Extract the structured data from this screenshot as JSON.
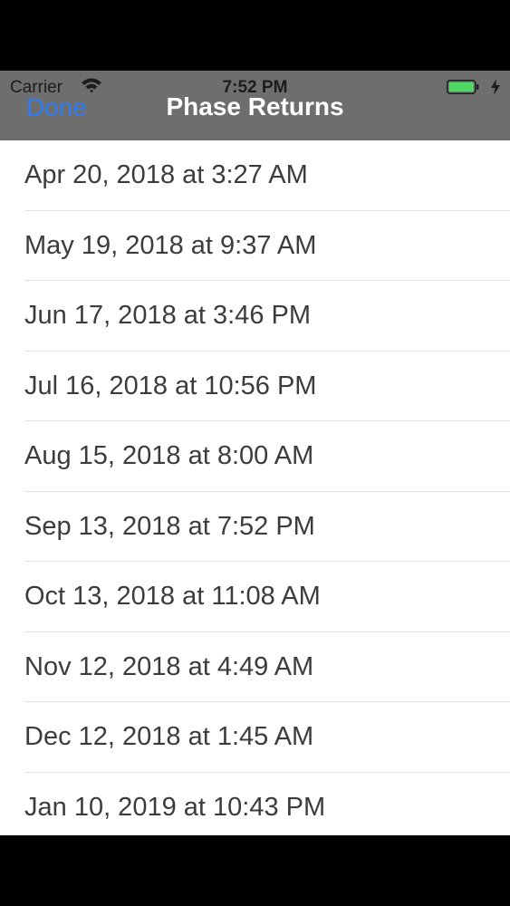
{
  "status_bar": {
    "carrier": "Carrier",
    "time": "7:52 PM",
    "wifi_icon": "wifi-icon",
    "battery_icon": "battery-icon",
    "charging_icon": "charging-bolt-icon",
    "battery_color": "#4cd964"
  },
  "nav": {
    "done_label": "Done",
    "title": "Phase Returns",
    "tint_color": "#2f7df6",
    "bar_color": "#6e6e6e"
  },
  "list": {
    "items": [
      "Apr 20, 2018 at 3:27 AM",
      "May 19, 2018 at 9:37 AM",
      "Jun 17, 2018 at 3:46 PM",
      "Jul 16, 2018 at 10:56 PM",
      "Aug 15, 2018 at 8:00 AM",
      "Sep 13, 2018 at 7:52 PM",
      "Oct 13, 2018 at 11:08 AM",
      "Nov 12, 2018 at 4:49 AM",
      "Dec 12, 2018 at 1:45 AM",
      "Jan 10, 2019 at 10:43 PM"
    ]
  }
}
